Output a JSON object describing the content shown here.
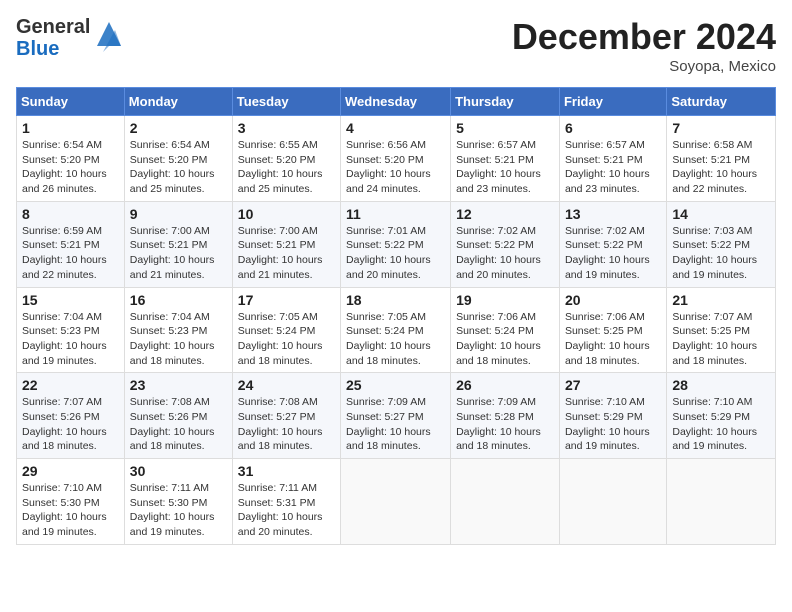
{
  "header": {
    "logo_line1": "General",
    "logo_line2": "Blue",
    "month_title": "December 2024",
    "location": "Soyopa, Mexico"
  },
  "weekdays": [
    "Sunday",
    "Monday",
    "Tuesday",
    "Wednesday",
    "Thursday",
    "Friday",
    "Saturday"
  ],
  "weeks": [
    [
      {
        "day": "1",
        "sunrise": "6:54 AM",
        "sunset": "5:20 PM",
        "daylight": "10 hours and 26 minutes."
      },
      {
        "day": "2",
        "sunrise": "6:54 AM",
        "sunset": "5:20 PM",
        "daylight": "10 hours and 25 minutes."
      },
      {
        "day": "3",
        "sunrise": "6:55 AM",
        "sunset": "5:20 PM",
        "daylight": "10 hours and 25 minutes."
      },
      {
        "day": "4",
        "sunrise": "6:56 AM",
        "sunset": "5:20 PM",
        "daylight": "10 hours and 24 minutes."
      },
      {
        "day": "5",
        "sunrise": "6:57 AM",
        "sunset": "5:21 PM",
        "daylight": "10 hours and 23 minutes."
      },
      {
        "day": "6",
        "sunrise": "6:57 AM",
        "sunset": "5:21 PM",
        "daylight": "10 hours and 23 minutes."
      },
      {
        "day": "7",
        "sunrise": "6:58 AM",
        "sunset": "5:21 PM",
        "daylight": "10 hours and 22 minutes."
      }
    ],
    [
      {
        "day": "8",
        "sunrise": "6:59 AM",
        "sunset": "5:21 PM",
        "daylight": "10 hours and 22 minutes."
      },
      {
        "day": "9",
        "sunrise": "7:00 AM",
        "sunset": "5:21 PM",
        "daylight": "10 hours and 21 minutes."
      },
      {
        "day": "10",
        "sunrise": "7:00 AM",
        "sunset": "5:21 PM",
        "daylight": "10 hours and 21 minutes."
      },
      {
        "day": "11",
        "sunrise": "7:01 AM",
        "sunset": "5:22 PM",
        "daylight": "10 hours and 20 minutes."
      },
      {
        "day": "12",
        "sunrise": "7:02 AM",
        "sunset": "5:22 PM",
        "daylight": "10 hours and 20 minutes."
      },
      {
        "day": "13",
        "sunrise": "7:02 AM",
        "sunset": "5:22 PM",
        "daylight": "10 hours and 19 minutes."
      },
      {
        "day": "14",
        "sunrise": "7:03 AM",
        "sunset": "5:22 PM",
        "daylight": "10 hours and 19 minutes."
      }
    ],
    [
      {
        "day": "15",
        "sunrise": "7:04 AM",
        "sunset": "5:23 PM",
        "daylight": "10 hours and 19 minutes."
      },
      {
        "day": "16",
        "sunrise": "7:04 AM",
        "sunset": "5:23 PM",
        "daylight": "10 hours and 18 minutes."
      },
      {
        "day": "17",
        "sunrise": "7:05 AM",
        "sunset": "5:24 PM",
        "daylight": "10 hours and 18 minutes."
      },
      {
        "day": "18",
        "sunrise": "7:05 AM",
        "sunset": "5:24 PM",
        "daylight": "10 hours and 18 minutes."
      },
      {
        "day": "19",
        "sunrise": "7:06 AM",
        "sunset": "5:24 PM",
        "daylight": "10 hours and 18 minutes."
      },
      {
        "day": "20",
        "sunrise": "7:06 AM",
        "sunset": "5:25 PM",
        "daylight": "10 hours and 18 minutes."
      },
      {
        "day": "21",
        "sunrise": "7:07 AM",
        "sunset": "5:25 PM",
        "daylight": "10 hours and 18 minutes."
      }
    ],
    [
      {
        "day": "22",
        "sunrise": "7:07 AM",
        "sunset": "5:26 PM",
        "daylight": "10 hours and 18 minutes."
      },
      {
        "day": "23",
        "sunrise": "7:08 AM",
        "sunset": "5:26 PM",
        "daylight": "10 hours and 18 minutes."
      },
      {
        "day": "24",
        "sunrise": "7:08 AM",
        "sunset": "5:27 PM",
        "daylight": "10 hours and 18 minutes."
      },
      {
        "day": "25",
        "sunrise": "7:09 AM",
        "sunset": "5:27 PM",
        "daylight": "10 hours and 18 minutes."
      },
      {
        "day": "26",
        "sunrise": "7:09 AM",
        "sunset": "5:28 PM",
        "daylight": "10 hours and 18 minutes."
      },
      {
        "day": "27",
        "sunrise": "7:10 AM",
        "sunset": "5:29 PM",
        "daylight": "10 hours and 19 minutes."
      },
      {
        "day": "28",
        "sunrise": "7:10 AM",
        "sunset": "5:29 PM",
        "daylight": "10 hours and 19 minutes."
      }
    ],
    [
      {
        "day": "29",
        "sunrise": "7:10 AM",
        "sunset": "5:30 PM",
        "daylight": "10 hours and 19 minutes."
      },
      {
        "day": "30",
        "sunrise": "7:11 AM",
        "sunset": "5:30 PM",
        "daylight": "10 hours and 19 minutes."
      },
      {
        "day": "31",
        "sunrise": "7:11 AM",
        "sunset": "5:31 PM",
        "daylight": "10 hours and 20 minutes."
      },
      null,
      null,
      null,
      null
    ]
  ]
}
